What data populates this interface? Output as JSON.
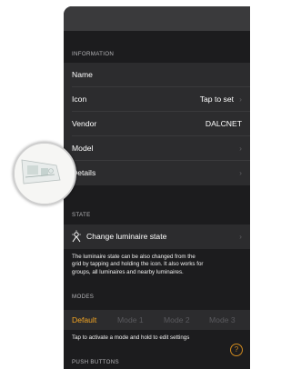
{
  "sections": {
    "information": "INFORMATION",
    "state": "STATE",
    "modes": "MODES",
    "push_buttons": "PUSH BUTTONS"
  },
  "info_rows": {
    "name": {
      "label": "Name"
    },
    "icon": {
      "label": "Icon",
      "value": "Tap to set"
    },
    "vendor": {
      "label": "Vendor",
      "value": "DALCNET"
    },
    "model": {
      "label": "Model"
    },
    "details": {
      "label": "Details"
    }
  },
  "state": {
    "change_label": "Change luminaire state",
    "note_line1": "The luminaire state can be also changed from the",
    "note_line2": "grid by tapping and holding the icon. It also works for",
    "note_line3": "groups, all luminaires and nearby luminaires."
  },
  "modes": {
    "items": [
      "Default",
      "Mode 1",
      "Mode 2",
      "Mode 3"
    ],
    "active": "Default",
    "hint": "Tap to activate a mode and hold to edit settings"
  },
  "glyphs": {
    "chevron": "›",
    "help": "?"
  },
  "colors": {
    "accent": "#f5a623",
    "background": "#1c1c1e",
    "row": "#2c2c2e"
  }
}
